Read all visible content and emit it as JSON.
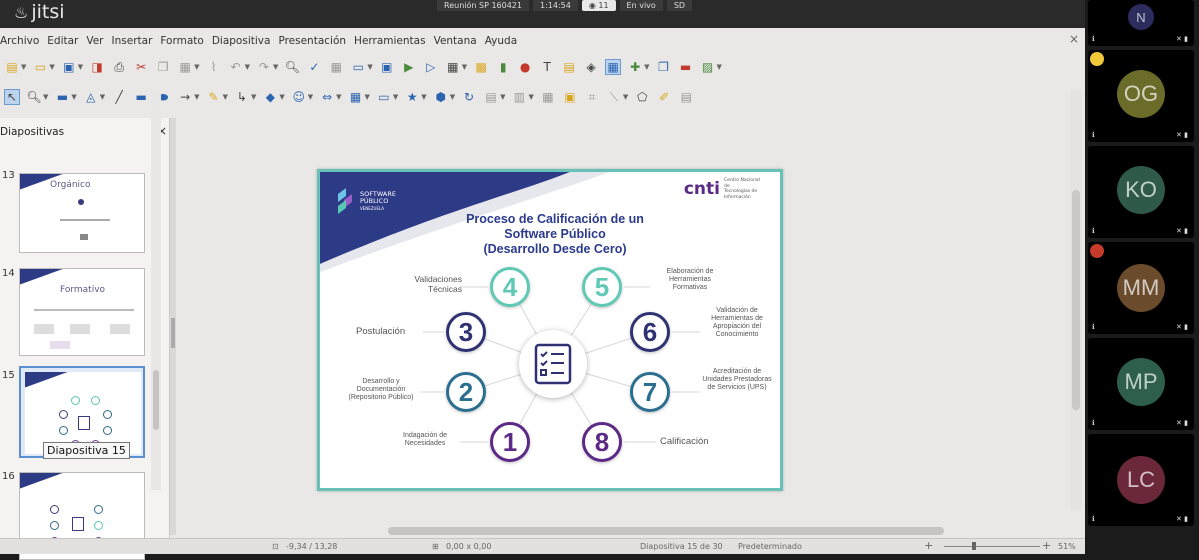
{
  "jitsi": {
    "logo": "jitsi",
    "meeting_name": "Reunión SP 160421",
    "timer": "1:14:54",
    "recording_count": "11",
    "live_label": "En vivo",
    "quality": "SD"
  },
  "menu": [
    "Archivo",
    "Editar",
    "Ver",
    "Insertar",
    "Formato",
    "Diapositiva",
    "Presentación",
    "Herramientas",
    "Ventana",
    "Ayuda"
  ],
  "menu_close": "×",
  "panel": {
    "title": "Diapositivas",
    "close": "×",
    "thumbs": [
      {
        "num": "13",
        "title": "Orgánico"
      },
      {
        "num": "14",
        "title": "Formativo"
      },
      {
        "num": "15",
        "title": ""
      },
      {
        "num": "16",
        "title": ""
      }
    ],
    "tooltip": "Diapositiva 15"
  },
  "slide": {
    "sp_name": [
      "SOFTWARE",
      "PÚBLICO",
      "VENEZUELA"
    ],
    "cnti_mark": "cnti",
    "cnti_name": [
      "Centro Nacional de",
      "Tecnologías de",
      "Información"
    ],
    "title": [
      "Proceso de Calificación de un",
      "Software Público",
      "(Desarrollo Desde Cero)"
    ],
    "steps": [
      {
        "n": "1",
        "label": "Indagación de Necesidades"
      },
      {
        "n": "2",
        "label": "Desarrollo y Documentación (Repositorio Público)"
      },
      {
        "n": "3",
        "label": "Postulación"
      },
      {
        "n": "4",
        "label": "Validaciones Técnicas"
      },
      {
        "n": "5",
        "label": "Elaboración de Herramientas Formativas"
      },
      {
        "n": "6",
        "label": "Validación de Herramientas de Apropiación del Conocimiento"
      },
      {
        "n": "7",
        "label": "Acreditación de Unidades Prestadoras de Servicios (UPS)"
      },
      {
        "n": "8",
        "label": "Calificación"
      }
    ]
  },
  "status": {
    "position": "-9,34 / 13,28",
    "size": "0,00 x 0,00",
    "slide_info": "Diapositiva 15 de 30",
    "layout": "Predeterminado",
    "zoom": "51%"
  },
  "participants": [
    {
      "initials": "N",
      "color": "#2c2c5e"
    },
    {
      "initials": "OG",
      "color": "#6b6b2a"
    },
    {
      "initials": "KO",
      "color": "#2f5a4a"
    },
    {
      "initials": "MM",
      "color": "#6a4b2c"
    },
    {
      "initials": "MP",
      "color": "#2d5f4a"
    },
    {
      "initials": "LC",
      "color": "#6a2838"
    }
  ]
}
